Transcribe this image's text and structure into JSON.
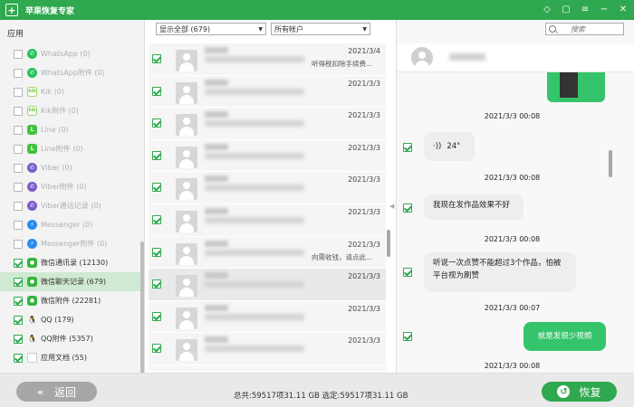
{
  "title": "苹果恢复专家",
  "sidebar": {
    "header": "应用",
    "items": [
      {
        "label": "WhatsApp (0)",
        "icon": "whatsapp-icon",
        "checked": false,
        "enabled": false,
        "selected": false
      },
      {
        "label": "WhatsApp附件 (0)",
        "icon": "whatsapp-icon",
        "checked": false,
        "enabled": false,
        "selected": false
      },
      {
        "label": "Kik (0)",
        "icon": "kik-icon",
        "checked": false,
        "enabled": false,
        "selected": false
      },
      {
        "label": "Kik附件 (0)",
        "icon": "kik-icon",
        "checked": false,
        "enabled": false,
        "selected": false
      },
      {
        "label": "Line (0)",
        "icon": "line-icon",
        "checked": false,
        "enabled": false,
        "selected": false
      },
      {
        "label": "Line附件 (0)",
        "icon": "line-icon",
        "checked": false,
        "enabled": false,
        "selected": false
      },
      {
        "label": "Viber (0)",
        "icon": "viber-icon",
        "checked": false,
        "enabled": false,
        "selected": false
      },
      {
        "label": "Viber附件 (0)",
        "icon": "viber-icon",
        "checked": false,
        "enabled": false,
        "selected": false
      },
      {
        "label": "Viber通话记录 (0)",
        "icon": "viber-icon",
        "checked": false,
        "enabled": false,
        "selected": false
      },
      {
        "label": "Messenger (0)",
        "icon": "messenger-icon",
        "checked": false,
        "enabled": false,
        "selected": false
      },
      {
        "label": "Messenger附件 (0)",
        "icon": "messenger-icon",
        "checked": false,
        "enabled": false,
        "selected": false
      },
      {
        "label": "微信通讯录 (12130)",
        "icon": "wechat-icon",
        "checked": true,
        "enabled": true,
        "selected": false
      },
      {
        "label": "微信聊天记录 (679)",
        "icon": "wechat-icon",
        "checked": true,
        "enabled": true,
        "selected": true
      },
      {
        "label": "微信附件 (22281)",
        "icon": "wechat-icon",
        "checked": true,
        "enabled": true,
        "selected": false
      },
      {
        "label": "QQ (179)",
        "icon": "qq-icon",
        "checked": true,
        "enabled": true,
        "selected": false
      },
      {
        "label": "QQ附件 (5357)",
        "icon": "qq-icon",
        "checked": true,
        "enabled": true,
        "selected": false
      },
      {
        "label": "应用文档 (55)",
        "icon": "document-icon",
        "checked": true,
        "enabled": true,
        "selected": false
      }
    ]
  },
  "filters": {
    "show": "显示全部 (679)",
    "account": "所有帐户"
  },
  "search": {
    "placeholder": "搜索"
  },
  "messages": [
    {
      "date": "2021/3/4",
      "snippet": "听得税扣除手续费..."
    },
    {
      "date": "2021/3/3",
      "snippet": ""
    },
    {
      "date": "2021/3/3",
      "snippet": ""
    },
    {
      "date": "2021/3/3",
      "snippet": ""
    },
    {
      "date": "2021/3/3",
      "snippet": ""
    },
    {
      "date": "2021/3/3",
      "snippet": ""
    },
    {
      "date": "2021/3/3",
      "snippet": "向需收钱，请点此..."
    },
    {
      "date": "2021/3/3",
      "snippet": ""
    },
    {
      "date": "2021/3/3",
      "snippet": ""
    },
    {
      "date": "2021/3/3",
      "snippet": ""
    }
  ],
  "chat": {
    "timestamps": [
      "2021/3/3 00:08",
      "2021/3/3 00:08",
      "2021/3/3 00:08",
      "2021/3/3 00:07",
      "2021/3/3 00:08"
    ],
    "voice_duration": "24\"",
    "msg2": "我现在发作品效果不好",
    "msg3_line1": "听说一次点赞不能超过3个作品，怕被",
    "msg3_line2": "平台视为刷赞",
    "msg4": "就是发很少视频"
  },
  "bottom": {
    "back_label": "返回",
    "recover_label": "恢复",
    "status": "总共:59517项31.11 GB 选定:59517项31.11 GB"
  },
  "colors": {
    "accent": "#2fa84f",
    "selected_row": "#cfe9d2",
    "outgoing_bubble": "#35c46b"
  }
}
